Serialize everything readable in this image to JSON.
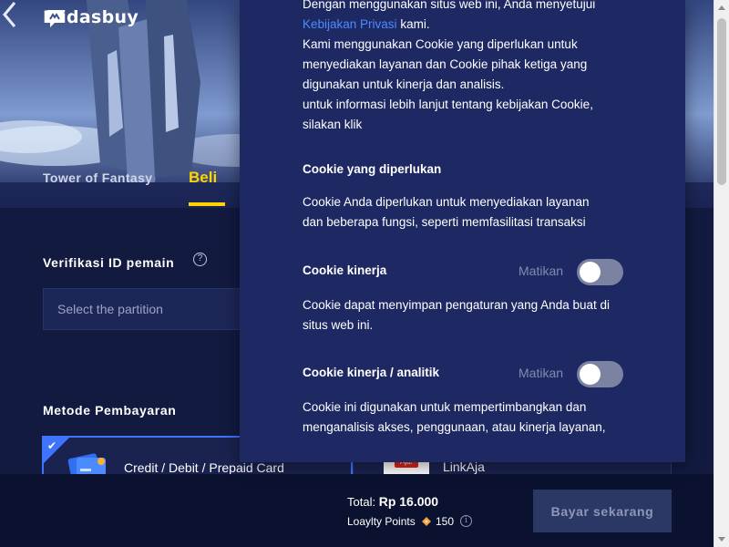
{
  "header": {
    "logo_text": "Midasbuy",
    "game_name": "Tower of Fantasy",
    "buy_tab": "Beli"
  },
  "player_id": {
    "title": "Verifikasi ID pemain",
    "help_icon": "?",
    "partition_placeholder": "Select the partition"
  },
  "payment": {
    "title": "Metode Pembayaran",
    "methods": [
      {
        "label": "Credit / Debit / Prepaid Card",
        "selected": true
      },
      {
        "label": "LinkAja",
        "selected": false
      }
    ]
  },
  "checkout": {
    "total_label": "Total:",
    "total_value": "Rp 16.000",
    "loyalty_label": "Loaylty Points",
    "loyalty_value": "150",
    "pay_button": "Bayar sekarang"
  },
  "cookie_panel": {
    "intro_line1": "Dengan menggunakan situs web ini, Anda menyetujui",
    "privacy_link": "Kebijakan Privasi",
    "intro_line2_suffix": " kami.",
    "intro_p2_l1": "Kami menggunakan Cookie yang diperlukan untuk",
    "intro_p2_l2": "menyediakan layanan dan Cookie pihak ketiga yang",
    "intro_p2_l3": "digunakan untuk kinerja dan analisis.",
    "intro_p3_l1": "untuk informasi lebih lanjut tentang kebijakan Cookie,",
    "intro_p3_l2": "silakan klik",
    "required": {
      "heading": "Cookie yang diperlukan",
      "desc_l1": "Cookie Anda diperlukan untuk menyediakan layanan",
      "desc_l2": "dan beberapa fungsi, seperti memfasilitasi transaksi"
    },
    "performance": {
      "heading": "Cookie kinerja",
      "toggle_label": "Matikan",
      "enabled": false,
      "desc_l1": "Cookie dapat menyimpan pengaturan yang Anda buat di",
      "desc_l2": "situs web ini."
    },
    "analytics": {
      "heading": "Cookie kinerja / analitik",
      "toggle_label": "Matikan",
      "enabled": false,
      "desc_l1": "Cookie ini digunakan untuk mempertimbangkan dan",
      "desc_l2": "menganalisis akses, penggunaan, atau kinerja layanan,"
    }
  },
  "colors": {
    "accent_yellow": "#ffd400",
    "accent_blue": "#3f74ff",
    "link_blue": "#4a8cff",
    "panel_bg": "#1e2963",
    "page_bg": "#121a40"
  }
}
